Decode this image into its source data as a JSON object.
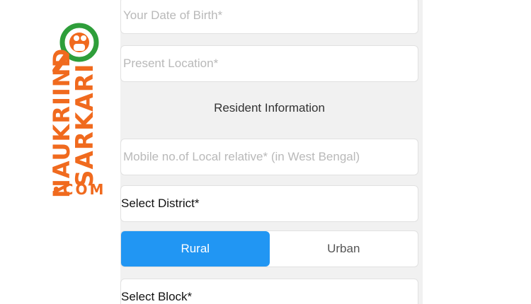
{
  "logo": {
    "line1": "SARKARI",
    "line2": "NAUKRIIND",
    "line3": "•COM",
    "brand_color": "#f06a1e",
    "accent_color": "#2e9e3a"
  },
  "form": {
    "dob_placeholder": "Your Date of Birth*",
    "location_placeholder": "Present Location*",
    "section_heading": "Resident Information",
    "relative_mobile_placeholder": "Mobile no.of Local relative* (in West Bengal)",
    "district_label": "Select District*",
    "area_type": {
      "options": [
        "Rural",
        "Urban"
      ],
      "selected": "Rural",
      "active_color": "#2196f3"
    },
    "block_label": "Select Block*"
  }
}
